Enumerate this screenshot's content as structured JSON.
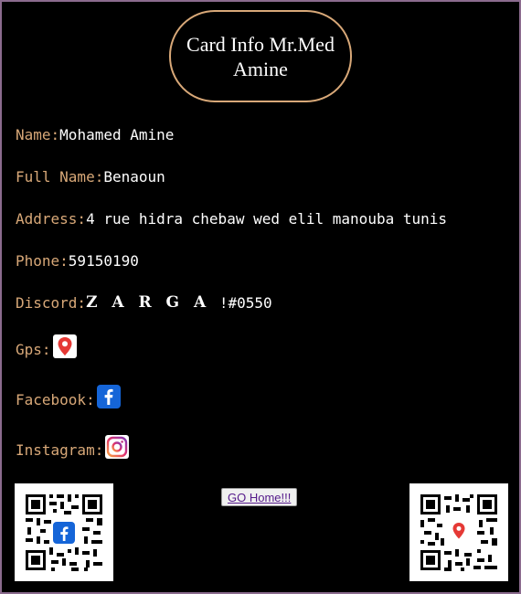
{
  "title": "Card Info Mr.Med Amine",
  "fields": {
    "name": {
      "label": "Name:",
      "value": "Mohamed Amine"
    },
    "full_name": {
      "label": "Full Name:",
      "value": "Benaoun"
    },
    "address": {
      "label": "Address:",
      "value": "4 rue hidra chebaw wed elil manouba tunis"
    },
    "phone": {
      "label": "Phone:",
      "value": "59150190"
    },
    "discord": {
      "label": "Discord:",
      "value": "Z A R G A",
      "tag": "!#0550"
    },
    "gps": {
      "label": "Gps:",
      "icon": "map-pin-icon"
    },
    "facebook": {
      "label": "Facebook:",
      "icon": "facebook-icon"
    },
    "instagram": {
      "label": "Instagram:",
      "icon": "instagram-icon"
    }
  },
  "home_button": {
    "label": "GO Home!!!"
  },
  "qr_codes": [
    {
      "icon": "facebook-qr-code"
    },
    {
      "icon": "map-pin-qr-code"
    }
  ],
  "colors": {
    "background": "#000000",
    "label": "#d8a878",
    "value": "#ffffff",
    "border": "#8b6b8e"
  }
}
